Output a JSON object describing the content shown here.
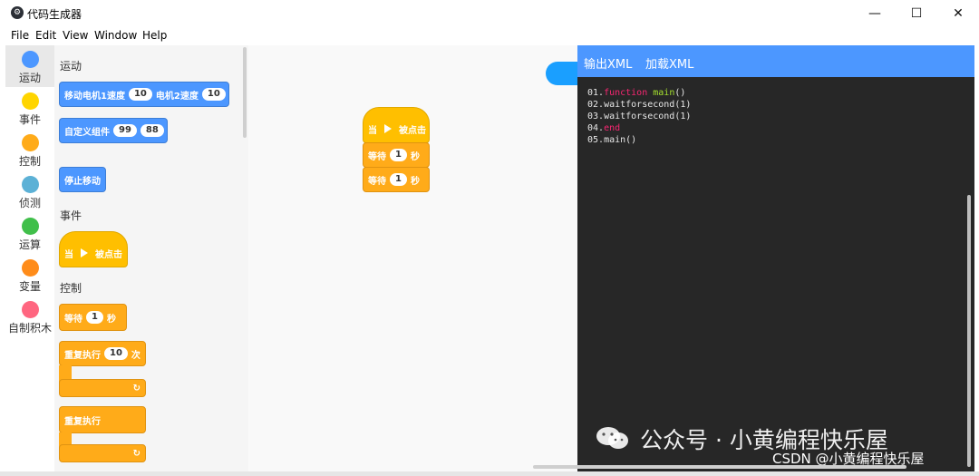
{
  "window": {
    "title": "代码生成器",
    "min": "—",
    "max": "☐",
    "close": "✕"
  },
  "menu": [
    "File",
    "Edit",
    "View",
    "Window",
    "Help"
  ],
  "categories": [
    {
      "label": "运动",
      "color": "#4c97ff"
    },
    {
      "label": "事件",
      "color": "#ffd500"
    },
    {
      "label": "控制",
      "color": "#ffab19"
    },
    {
      "label": "侦测",
      "color": "#5cb1d6"
    },
    {
      "label": "运算",
      "color": "#40bf4a"
    },
    {
      "label": "变量",
      "color": "#ff8c1a"
    },
    {
      "label": "自制积木",
      "color": "#ff6680"
    }
  ],
  "flyout": {
    "motion_label": "运动",
    "move_motor": {
      "p1": "移动电机1速度",
      "v1": "10",
      "p2": "电机2速度",
      "v2": "10"
    },
    "custom_comp": {
      "label": "自定义组件",
      "v1": "99",
      "v2": "88"
    },
    "stop_move": "停止移动",
    "events_label": "事件",
    "when_clicked": {
      "p1": "当",
      "p2": "被点击"
    },
    "control_label": "控制",
    "wait": {
      "p1": "等待",
      "v": "1",
      "p2": "秒"
    },
    "repeat": {
      "p1": "重复执行",
      "v": "10",
      "p2": "次"
    },
    "forever": "重复执行",
    "loop_arrow": "↻"
  },
  "workspace": {
    "hat": {
      "p1": "当",
      "p2": "被点击"
    },
    "wait1": {
      "p1": "等待",
      "v": "1",
      "p2": "秒"
    },
    "wait2": {
      "p1": "等待",
      "v": "1",
      "p2": "秒"
    }
  },
  "code_panel": {
    "export_xml": "输出XML",
    "load_xml": "加载XML",
    "lines": [
      {
        "num": "01.",
        "kw": "function",
        "fn": "main",
        "rest": "()"
      },
      {
        "num": "02.",
        "text": "waitforsecond(1)"
      },
      {
        "num": "03.",
        "text": "waitforsecond(1)"
      },
      {
        "num": "04.",
        "kw": "end"
      },
      {
        "num": "05.",
        "text": "main()"
      }
    ]
  },
  "watermark": {
    "line1": "公众号 · 小黄编程快乐屋",
    "line2": "CSDN @小黄编程快乐屋"
  },
  "colors": {
    "accent": "#4c97ff",
    "code_bg": "#272727",
    "keyword": "#f92672",
    "function": "#a6e22e"
  }
}
